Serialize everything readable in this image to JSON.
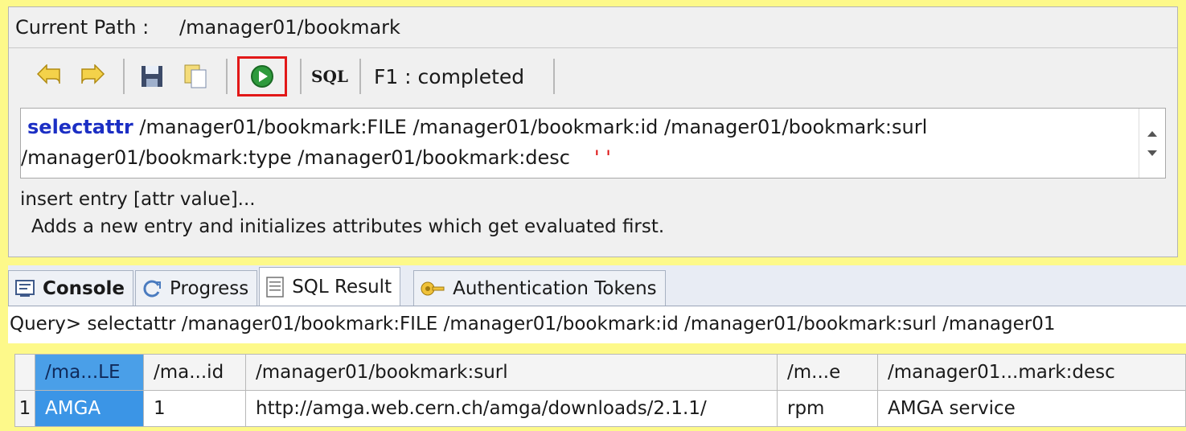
{
  "path": {
    "label": "Current Path :",
    "value": "/manager01/bookmark"
  },
  "toolbar": {
    "sql_label": "SQL",
    "status": "F1 : completed"
  },
  "editor": {
    "keyword": "selectattr",
    "line1_rest": " /manager01/bookmark:FILE /manager01/bookmark:id /manager01/bookmark:surl",
    "line2": "/manager01/bookmark:type /manager01/bookmark:desc",
    "quotes": "' '"
  },
  "help": {
    "command": "insert entry [attr value]...",
    "description": "Adds a new entry and initializes attributes which get evaluated first."
  },
  "tabs": [
    {
      "label": "Console",
      "icon": "console-icon"
    },
    {
      "label": "Progress",
      "icon": "progress-icon"
    },
    {
      "label": "SQL Result",
      "icon": "sql-result-icon"
    },
    {
      "label": "Authentication Tokens",
      "icon": "authentication-tokens-icon"
    }
  ],
  "query": "Query> selectattr /manager01/bookmark:FILE /manager01/bookmark:id /manager01/bookmark:surl /manager01",
  "table": {
    "columns": [
      "/ma...LE",
      "/ma...id",
      "/manager01/bookmark:surl",
      "/m...e",
      "/manager01...mark:desc"
    ],
    "rows": [
      {
        "num": "1",
        "cells": [
          "AMGA",
          "1",
          "http://amga.web.cern.ch/amga/downloads/2.1.1/",
          "rpm",
          "AMGA service"
        ]
      }
    ]
  }
}
